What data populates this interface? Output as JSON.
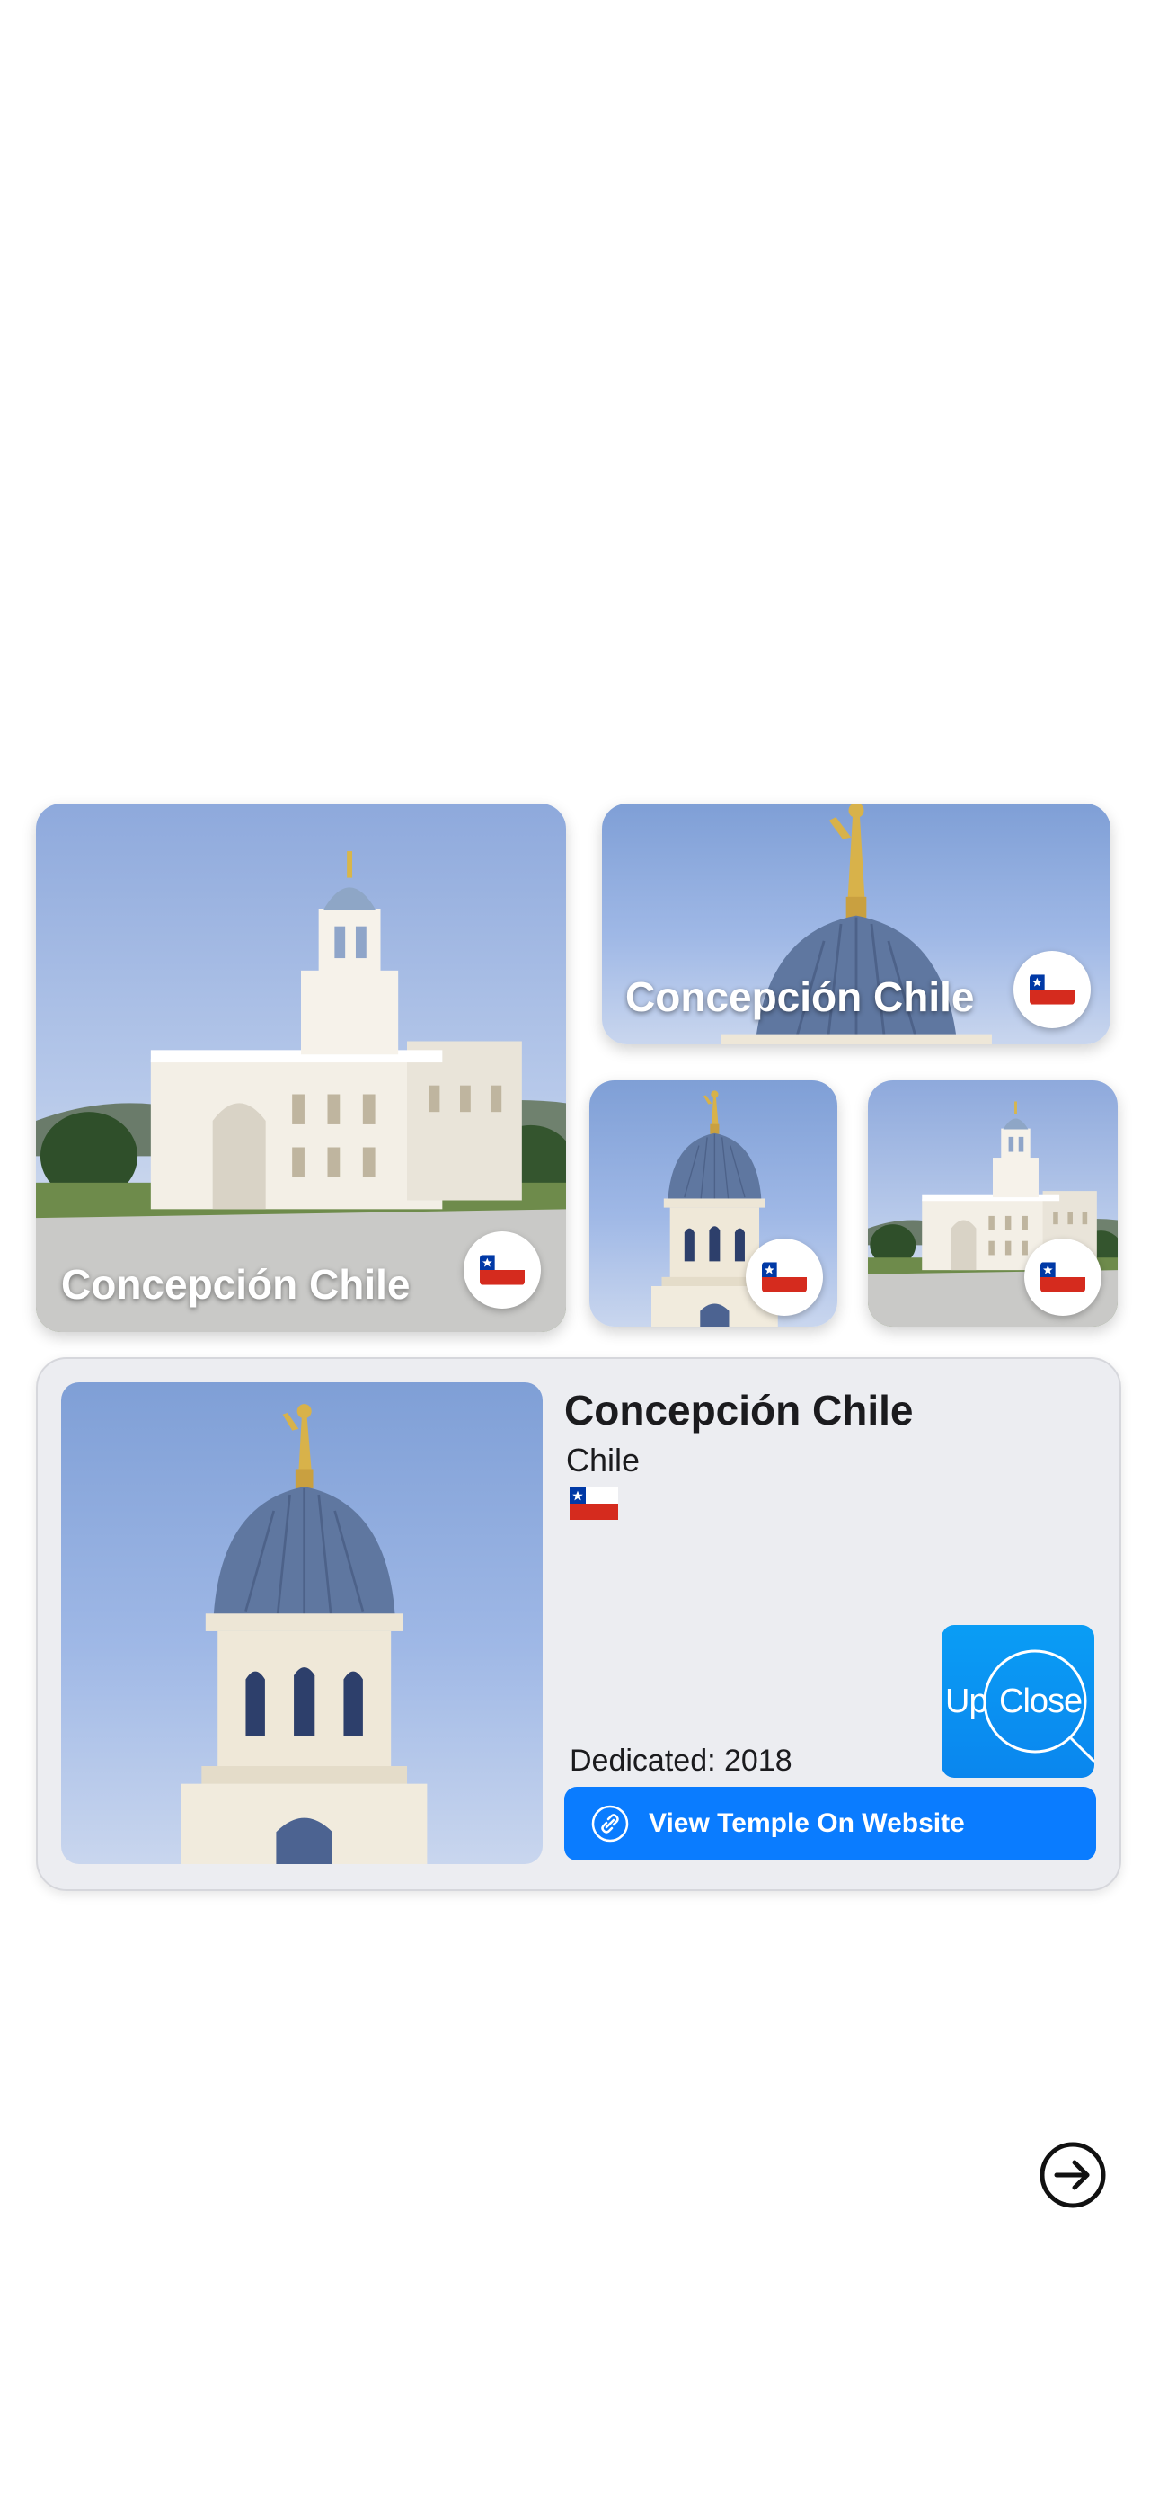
{
  "tiles": {
    "large": {
      "title": "Concepción Chile",
      "flag": "chile-flag"
    },
    "top_right": {
      "title": "Concepción Chile",
      "flag": "chile-flag"
    },
    "small_left": {
      "flag": "chile-flag"
    },
    "small_right": {
      "flag": "chile-flag"
    }
  },
  "detail": {
    "title": "Concepción Chile",
    "country": "Chile",
    "flag": "chile-flag",
    "dedicated": "Dedicated: 2018",
    "upclose_up": "Up",
    "upclose_close": "Close",
    "website_button": "View Temple On Website",
    "link_icon": "link-icon"
  },
  "navigation": {
    "next_icon": "arrow-right-circle-icon"
  },
  "colors": {
    "accent_blue": "#0a7cff",
    "upclose_blue": "#0a8ff0",
    "card_background": "#ecedf1",
    "sky": "#9fb8e6",
    "text": "#1b1b1e"
  }
}
